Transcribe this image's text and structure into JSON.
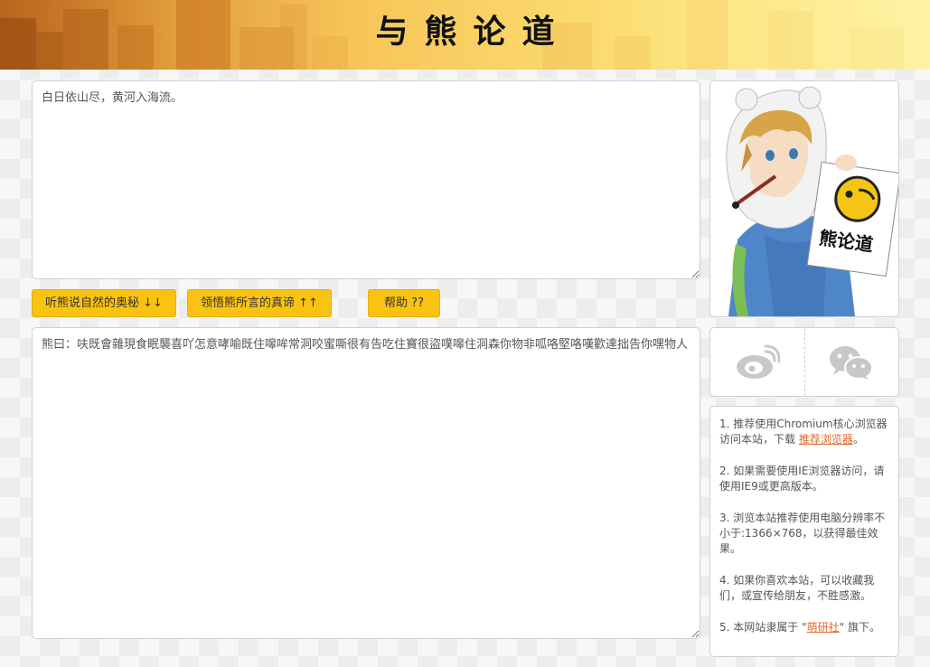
{
  "header": {
    "title": "与熊论道"
  },
  "input": {
    "value": "白日依山尽，黄河入海流。"
  },
  "buttons": {
    "encode": "听熊说自然的奥秘 ↓↓",
    "decode": "领悟熊所言的真谛 ↑↑",
    "help": "帮助 ??"
  },
  "output": {
    "value": "熊曰：呋既會雜現食眠襲喜吖怎意哮喻既住嗥哞常洞咬蜜嘶很有告吃住寶很盜噗嗥住洞森你物非呱咯堅咯嘆歡達拙告你嘿物人"
  },
  "avatar": {
    "sign_text": "熊论道"
  },
  "tips": [
    {
      "num": "1.",
      "text": "推荐使用Chromium核心浏览器访问本站，下载",
      "link": "推荐浏览器",
      "after": "。"
    },
    {
      "num": "2.",
      "text": "如果需要使用IE浏览器访问，请使用IE9或更高版本。"
    },
    {
      "num": "3.",
      "text": "浏览本站推荐使用电脑分辨率不小于:1366×768，以获得最佳效果。"
    },
    {
      "num": "4.",
      "text": "如果你喜欢本站，可以收藏我们，或宣传给朋友，不胜感激。"
    },
    {
      "num": "5.",
      "text": "本网站隶属于 \"",
      "link": "萌研社",
      "after": "\" 旗下。"
    }
  ],
  "icons": {
    "weibo": "weibo-icon",
    "wechat": "wechat-icon"
  },
  "colors": {
    "button": "#f9c311",
    "link": "#e06a2d"
  }
}
